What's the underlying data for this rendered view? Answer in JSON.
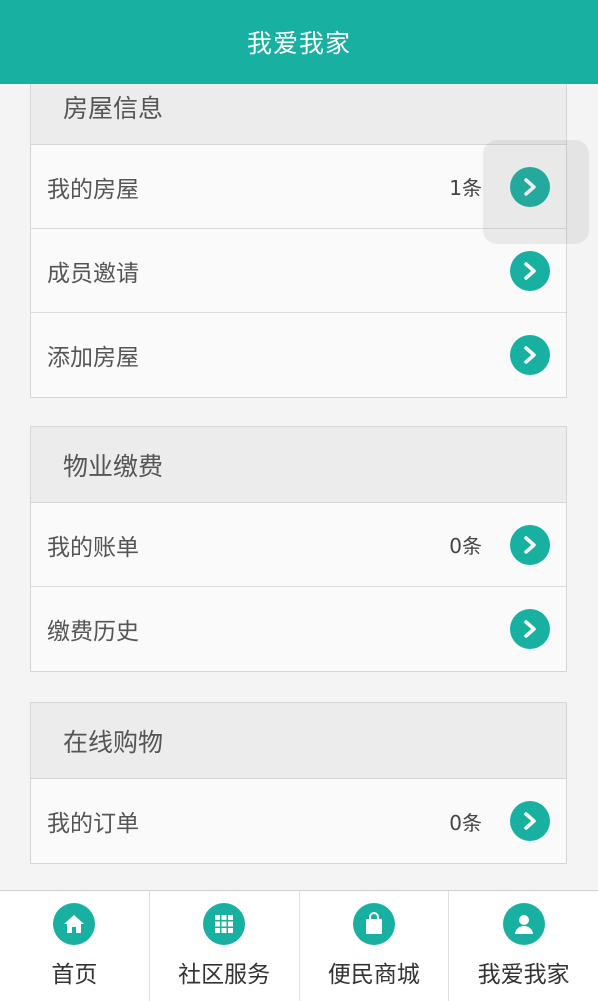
{
  "header": {
    "title": "我爱我家"
  },
  "sections": [
    {
      "title": "房屋信息",
      "rows": [
        {
          "label": "我的房屋",
          "count": "1条"
        },
        {
          "label": "成员邀请",
          "count": ""
        },
        {
          "label": "添加房屋",
          "count": ""
        }
      ]
    },
    {
      "title": "物业缴费",
      "rows": [
        {
          "label": "我的账单",
          "count": "0条"
        },
        {
          "label": "缴费历史",
          "count": ""
        }
      ]
    },
    {
      "title": "在线购物",
      "rows": [
        {
          "label": "我的订单",
          "count": "0条"
        }
      ]
    }
  ],
  "tabs": [
    {
      "label": "首页",
      "icon": "home-icon"
    },
    {
      "label": "社区服务",
      "icon": "grid-icon"
    },
    {
      "label": "便民商城",
      "icon": "shopping-bag-icon"
    },
    {
      "label": "我爱我家",
      "icon": "user-icon"
    }
  ],
  "colors": {
    "accent": "#18b1a1"
  }
}
